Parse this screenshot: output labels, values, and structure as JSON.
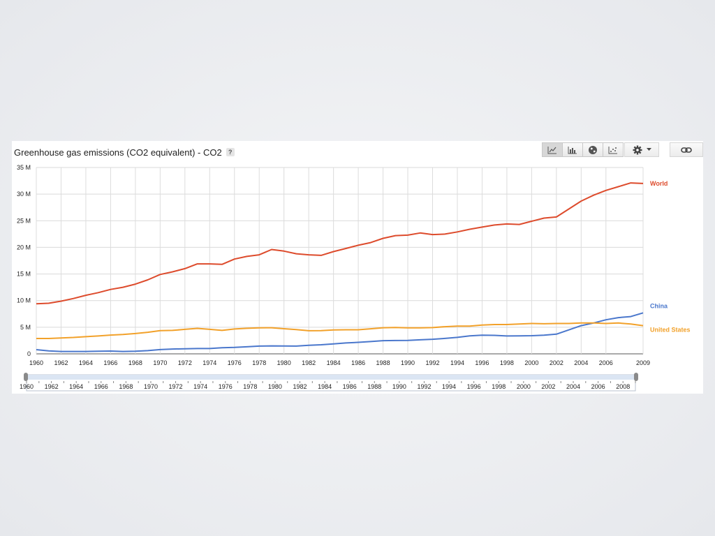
{
  "header": {
    "title": "Greenhouse gas emissions (CO2 equivalent) - CO2",
    "help": "?"
  },
  "toolbar": {
    "buttons": [
      {
        "icon": "line-chart-icon",
        "active": true
      },
      {
        "icon": "bar-chart-icon",
        "active": false
      },
      {
        "icon": "globe-icon",
        "active": false
      },
      {
        "icon": "scatter-chart-icon",
        "active": false
      }
    ],
    "settings_icon": "gear-icon",
    "dropdown_icon": "caret-down-icon",
    "link_icon": "link-icon"
  },
  "chart_data": {
    "type": "line",
    "title": "Greenhouse gas emissions (CO2 equivalent) - CO2",
    "x": [
      1960,
      1961,
      1962,
      1963,
      1964,
      1965,
      1966,
      1967,
      1968,
      1969,
      1970,
      1971,
      1972,
      1973,
      1974,
      1975,
      1976,
      1977,
      1978,
      1979,
      1980,
      1981,
      1982,
      1983,
      1984,
      1985,
      1986,
      1987,
      1988,
      1989,
      1990,
      1991,
      1992,
      1993,
      1994,
      1995,
      1996,
      1997,
      1998,
      1999,
      2000,
      2001,
      2002,
      2003,
      2004,
      2005,
      2006,
      2007,
      2008,
      2009
    ],
    "x_ticks": [
      1960,
      1962,
      1964,
      1966,
      1968,
      1970,
      1972,
      1974,
      1976,
      1978,
      1980,
      1982,
      1984,
      1986,
      1988,
      1990,
      1992,
      1994,
      1996,
      1998,
      2000,
      2002,
      2004,
      2006,
      2009
    ],
    "y_ticks": [
      "0",
      "5 M",
      "10 M",
      "15 M",
      "20 M",
      "25 M",
      "30 M",
      "35 M"
    ],
    "ylim": [
      0,
      35000000
    ],
    "grid": true,
    "legend_position": "right, at line ends",
    "series": [
      {
        "name": "World",
        "color": "#dd4b2c",
        "values": [
          9.4,
          9.5,
          9.9,
          10.4,
          11.0,
          11.5,
          12.1,
          12.5,
          13.1,
          13.9,
          14.9,
          15.4,
          16.0,
          16.9,
          16.9,
          16.8,
          17.8,
          18.3,
          18.6,
          19.6,
          19.3,
          18.8,
          18.6,
          18.5,
          19.2,
          19.8,
          20.4,
          20.9,
          21.7,
          22.2,
          22.3,
          22.7,
          22.4,
          22.5,
          22.9,
          23.4,
          23.8,
          24.2,
          24.4,
          24.3,
          24.9,
          25.5,
          25.7,
          27.2,
          28.7,
          29.8,
          30.7,
          31.4,
          32.1,
          32.0
        ]
      },
      {
        "name": "China",
        "color": "#4a77cc",
        "values": [
          0.78,
          0.55,
          0.44,
          0.44,
          0.44,
          0.48,
          0.53,
          0.45,
          0.48,
          0.6,
          0.8,
          0.9,
          0.96,
          1.0,
          1.0,
          1.15,
          1.2,
          1.32,
          1.46,
          1.49,
          1.47,
          1.45,
          1.6,
          1.7,
          1.86,
          2.04,
          2.16,
          2.31,
          2.48,
          2.51,
          2.52,
          2.63,
          2.74,
          2.9,
          3.09,
          3.38,
          3.5,
          3.48,
          3.36,
          3.38,
          3.41,
          3.5,
          3.7,
          4.5,
          5.3,
          5.8,
          6.4,
          6.8,
          7.0,
          7.7
        ]
      },
      {
        "name": "United States",
        "color": "#f2a12a",
        "values": [
          2.89,
          2.88,
          2.99,
          3.08,
          3.23,
          3.36,
          3.53,
          3.65,
          3.81,
          4.05,
          4.35,
          4.4,
          4.6,
          4.78,
          4.6,
          4.41,
          4.67,
          4.8,
          4.89,
          4.9,
          4.72,
          4.55,
          4.34,
          4.35,
          4.5,
          4.52,
          4.52,
          4.7,
          4.9,
          4.95,
          4.89,
          4.87,
          4.93,
          5.1,
          5.2,
          5.2,
          5.4,
          5.5,
          5.5,
          5.6,
          5.7,
          5.65,
          5.7,
          5.7,
          5.8,
          5.8,
          5.7,
          5.8,
          5.6,
          5.3
        ]
      }
    ]
  },
  "range_slider": {
    "labels": [
      "1960",
      "1962",
      "1964",
      "1966",
      "1968",
      "1970",
      "1972",
      "1974",
      "1976",
      "1978",
      "1980",
      "1982",
      "1984",
      "1986",
      "1988",
      "1990",
      "1992",
      "1994",
      "1996",
      "1998",
      "2000",
      "2002",
      "2004",
      "2006",
      "2008"
    ],
    "start_year": 1960,
    "end_year": 2009
  }
}
